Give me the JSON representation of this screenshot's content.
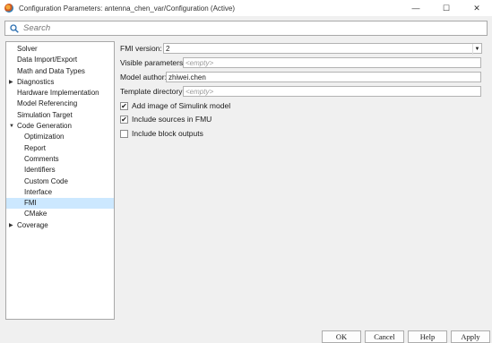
{
  "window": {
    "title": "Configuration Parameters: antenna_chen_var/Configuration (Active)",
    "minimize": "—",
    "maximize": "☐",
    "close": "✕"
  },
  "search": {
    "placeholder": "Search"
  },
  "tree": {
    "items": [
      {
        "label": "Solver"
      },
      {
        "label": "Data Import/Export"
      },
      {
        "label": "Math and Data Types"
      },
      {
        "label": "Diagnostics",
        "arrow": "▶"
      },
      {
        "label": "Hardware Implementation"
      },
      {
        "label": "Model Referencing"
      },
      {
        "label": "Simulation Target"
      },
      {
        "label": "Code Generation",
        "arrow": "▼"
      },
      {
        "label": "Optimization"
      },
      {
        "label": "Report"
      },
      {
        "label": "Comments"
      },
      {
        "label": "Identifiers"
      },
      {
        "label": "Custom Code"
      },
      {
        "label": "Interface"
      },
      {
        "label": "FMI"
      },
      {
        "label": "CMake"
      },
      {
        "label": "Coverage",
        "arrow": "▶"
      }
    ]
  },
  "form": {
    "fmi_version_label": "FMI version:",
    "fmi_version_value": "2",
    "visible_params_label": "Visible parameters:",
    "visible_params_placeholder": "<empty>",
    "model_author_label": "Model author:",
    "model_author_value": "zhiwei.chen",
    "template_dir_label": "Template directory:",
    "template_dir_placeholder": "<empty>",
    "add_image_label": "Add image of Simulink model",
    "add_image_checked": "✔",
    "include_sources_label": "Include sources in FMU",
    "include_sources_checked": "✔",
    "include_block_outputs_label": "Include block outputs"
  },
  "footer": {
    "ok": "OK",
    "cancel": "Cancel",
    "help": "Help",
    "apply": "Apply"
  }
}
